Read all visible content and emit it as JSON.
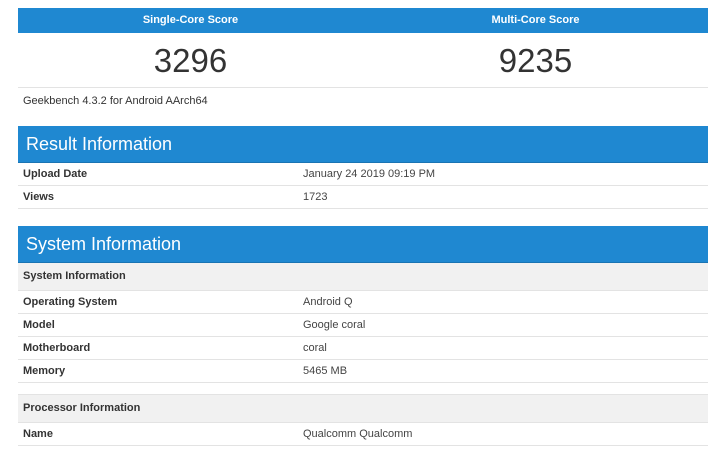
{
  "scores": {
    "single_label": "Single-Core Score",
    "single_value": "3296",
    "multi_label": "Multi-Core Score",
    "multi_value": "9235",
    "version_note": "Geekbench 4.3.2 for Android AArch64"
  },
  "result_info": {
    "title": "Result Information",
    "rows": [
      {
        "key": "Upload Date",
        "value": "January 24 2019 09:19 PM"
      },
      {
        "key": "Views",
        "value": "1723"
      }
    ]
  },
  "system_info": {
    "title": "System Information",
    "subsection1": "System Information",
    "rows": [
      {
        "key": "Operating System",
        "value": "Android Q"
      },
      {
        "key": "Model",
        "value": "Google coral"
      },
      {
        "key": "Motherboard",
        "value": "coral"
      },
      {
        "key": "Memory",
        "value": "5465 MB"
      }
    ],
    "subsection2": "Processor Information",
    "proc_rows": [
      {
        "key": "Name",
        "value": "Qualcomm Qualcomm"
      }
    ]
  },
  "colors": {
    "header_blue": "#1f88d1",
    "row_border": "#e3e3e3",
    "subheader_bg": "#f1f1f1"
  }
}
